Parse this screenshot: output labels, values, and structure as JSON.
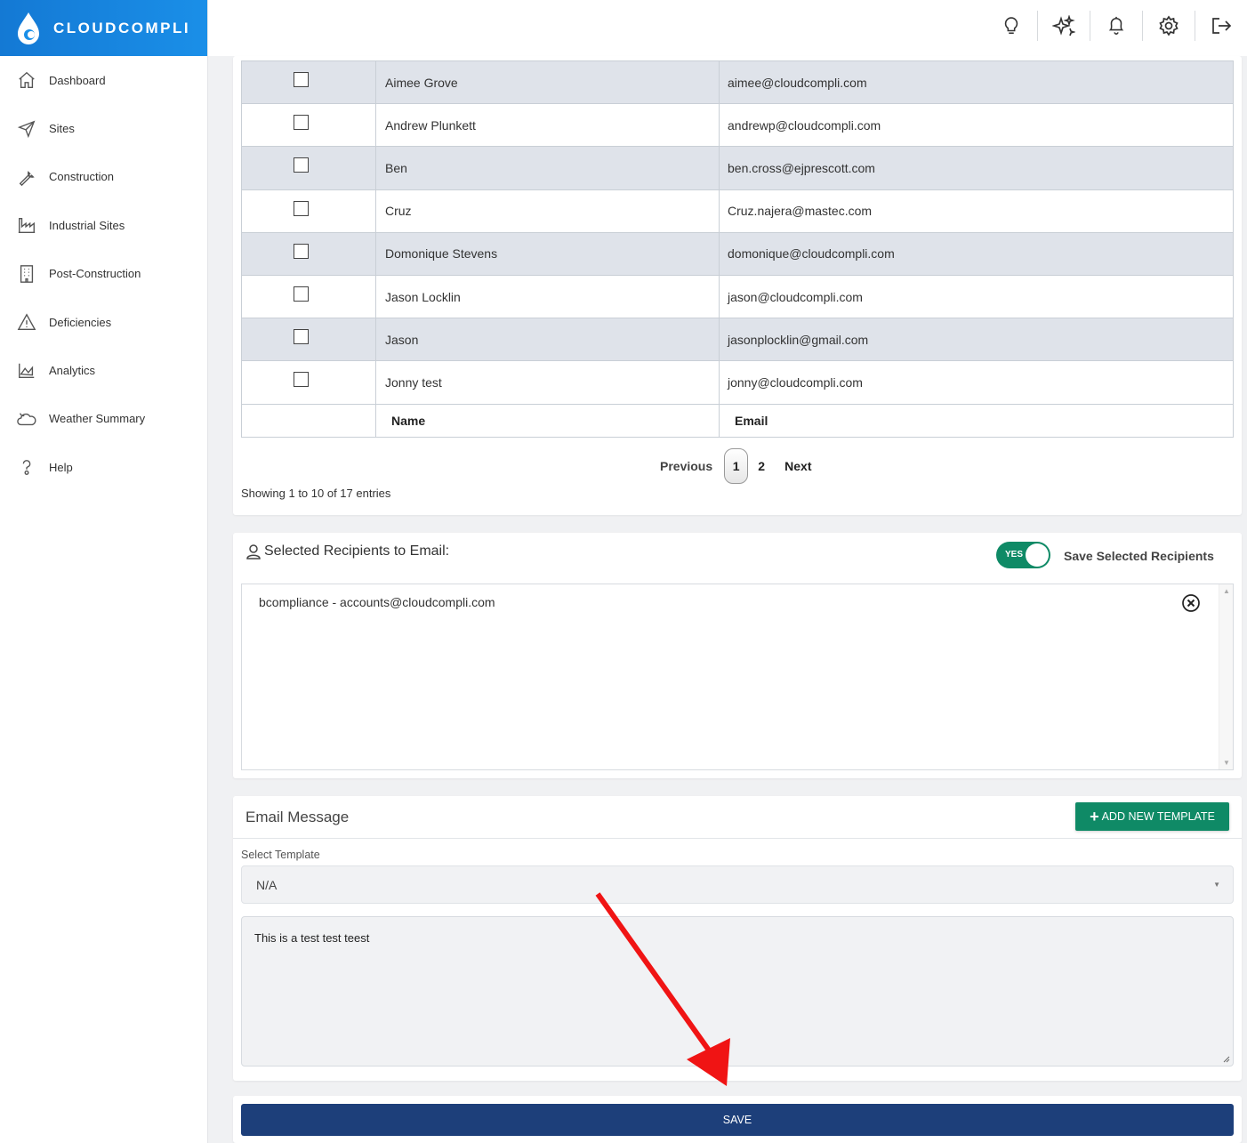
{
  "brand": {
    "name": "CLOUDCOMPLI",
    "color": "#1479d4"
  },
  "sidebar": {
    "items": [
      {
        "label": "Dashboard",
        "icon": "home-icon"
      },
      {
        "label": "Sites",
        "icon": "send-icon"
      },
      {
        "label": "Construction",
        "icon": "wrench-icon"
      },
      {
        "label": "Industrial Sites",
        "icon": "factory-icon"
      },
      {
        "label": "Post-Construction",
        "icon": "building-icon"
      },
      {
        "label": "Deficiencies",
        "icon": "warning-icon"
      },
      {
        "label": "Analytics",
        "icon": "chart-icon"
      },
      {
        "label": "Weather Summary",
        "icon": "cloud-icon"
      },
      {
        "label": "Help",
        "icon": "question-icon"
      }
    ]
  },
  "topbar": {
    "icons": [
      "lightbulb-icon",
      "sparkle-icon",
      "bell-icon",
      "gear-icon",
      "logout-icon"
    ]
  },
  "table": {
    "rows": [
      {
        "name": "Aimee Grove",
        "email": "aimee@cloudcompli.com"
      },
      {
        "name": "Andrew Plunkett",
        "email": "andrewp@cloudcompli.com"
      },
      {
        "name": "Ben",
        "email": "ben.cross@ejprescott.com"
      },
      {
        "name": "Cruz",
        "email": "Cruz.najera@mastec.com"
      },
      {
        "name": "Domonique Stevens",
        "email": "domonique@cloudcompli.com"
      },
      {
        "name": "Jason Locklin",
        "email": "jason@cloudcompli.com"
      },
      {
        "name": "Jason",
        "email": "jasonplocklin@gmail.com"
      },
      {
        "name": "Jonny test",
        "email": "jonny@cloudcompli.com"
      }
    ],
    "col_name": "Name",
    "col_email": "Email",
    "pager": {
      "previous": "Previous",
      "page1": "1",
      "page2": "2",
      "next": "Next"
    },
    "showing": "Showing 1 to 10 of 17 entries"
  },
  "recipients": {
    "title": "Selected Recipients to Email:",
    "toggle_label": "YES",
    "toggle_on": true,
    "save_label": "Save Selected Recipients",
    "items": [
      "bcompliance - accounts@cloudcompli.com"
    ]
  },
  "email": {
    "title": "Email Message",
    "add_template": "ADD NEW TEMPLATE",
    "template_label": "Select Template",
    "template_value": "N/A",
    "message": "This is a test test teest"
  },
  "save_button": "SAVE",
  "colors": {
    "accent_green": "#0f8a66",
    "save_blue": "#1d3f7a",
    "row_alt": "#dfe3ea",
    "arrow_red": "#f01414"
  }
}
